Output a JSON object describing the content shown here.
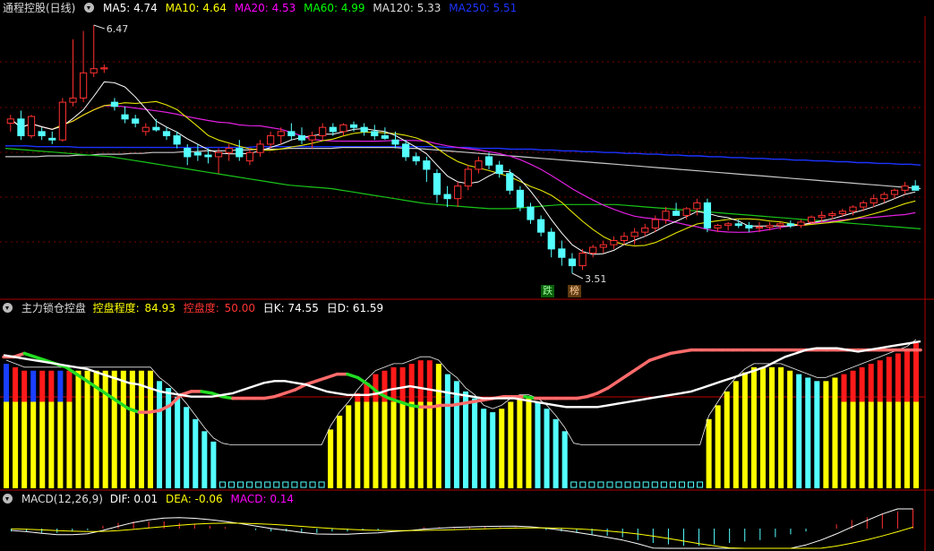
{
  "colors": {
    "ma5": "#ffffff",
    "ma10": "#ffff00",
    "ma20": "#ff00ff",
    "ma60": "#00ff00",
    "ma120": "#ffffff",
    "ma250": "#0000ff",
    "up": "#ff3030",
    "down": "#54ffff",
    "grid": "#7a0000"
  },
  "main": {
    "title": "通程控股(日线)",
    "indicators": [
      {
        "label": "MA5: 4.74",
        "color": "#ffffff"
      },
      {
        "label": "MA10: 4.64",
        "color": "#ffff00"
      },
      {
        "label": "MA20: 4.53",
        "color": "#ff00ff"
      },
      {
        "label": "MA60: 4.99",
        "color": "#00ff00"
      },
      {
        "label": "MA120: 5.33",
        "color": "#ffffff"
      },
      {
        "label": "MA250: 5.51",
        "color": "#0000ff"
      }
    ],
    "high_label": "6.47",
    "low_label": "3.51",
    "marker_fall": "跌",
    "marker_rank": "榜"
  },
  "panel2": {
    "title": "主力锁仓控盘",
    "items": [
      {
        "label": "控盘程度:",
        "color": "#ffff00"
      },
      {
        "label": "84.93",
        "color": "#ffff00"
      },
      {
        "label": "控盘度:",
        "color": "#ff3030"
      },
      {
        "label": "50.00",
        "color": "#ff3030"
      },
      {
        "label": "日K: 74.55",
        "color": "#ffffff"
      },
      {
        "label": "日D: 61.59",
        "color": "#ffffff"
      }
    ]
  },
  "macd": {
    "title": "MACD(12,26,9)",
    "items": [
      {
        "label": "DIF: 0.01",
        "color": "#ffffff"
      },
      {
        "label": "DEA: -0.06",
        "color": "#ffff00"
      },
      {
        "label": "MACD: 0.14",
        "color": "#ff00ff"
      }
    ]
  },
  "chart_data": {
    "type": "candlestick",
    "candles": [
      [
        5.3,
        5.4,
        5.2,
        5.35
      ],
      [
        5.35,
        5.45,
        5.1,
        5.15
      ],
      [
        5.15,
        5.4,
        5.12,
        5.38
      ],
      [
        5.2,
        5.25,
        5.1,
        5.15
      ],
      [
        5.12,
        5.2,
        5.05,
        5.1
      ],
      [
        5.1,
        5.6,
        5.08,
        5.55
      ],
      [
        5.55,
        6.3,
        5.5,
        5.6
      ],
      [
        5.6,
        6.4,
        5.55,
        5.9
      ],
      [
        5.9,
        6.47,
        5.85,
        5.95
      ],
      [
        5.95,
        6.0,
        5.9,
        5.96
      ],
      [
        5.55,
        5.6,
        5.45,
        5.5
      ],
      [
        5.4,
        5.5,
        5.3,
        5.35
      ],
      [
        5.35,
        5.4,
        5.25,
        5.3
      ],
      [
        5.2,
        5.3,
        5.15,
        5.25
      ],
      [
        5.25,
        5.35,
        5.2,
        5.22
      ],
      [
        5.2,
        5.25,
        5.1,
        5.15
      ],
      [
        5.15,
        5.2,
        5.0,
        5.05
      ],
      [
        5.0,
        5.05,
        4.8,
        4.9
      ],
      [
        4.95,
        5.05,
        4.85,
        4.92
      ],
      [
        4.92,
        5.0,
        4.82,
        4.9
      ],
      [
        4.9,
        5.0,
        4.7,
        4.95
      ],
      [
        4.95,
        5.05,
        4.85,
        5.0
      ],
      [
        5.0,
        5.1,
        4.85,
        4.9
      ],
      [
        4.85,
        5.0,
        4.8,
        4.95
      ],
      [
        4.95,
        5.1,
        4.9,
        5.05
      ],
      [
        5.05,
        5.2,
        5.0,
        5.15
      ],
      [
        5.15,
        5.25,
        5.05,
        5.2
      ],
      [
        5.2,
        5.3,
        5.1,
        5.15
      ],
      [
        5.15,
        5.25,
        5.05,
        5.1
      ],
      [
        5.1,
        5.2,
        5.0,
        5.15
      ],
      [
        5.15,
        5.3,
        5.1,
        5.25
      ],
      [
        5.25,
        5.3,
        5.15,
        5.2
      ],
      [
        5.2,
        5.3,
        5.15,
        5.28
      ],
      [
        5.28,
        5.32,
        5.2,
        5.25
      ],
      [
        5.25,
        5.3,
        5.15,
        5.2
      ],
      [
        5.2,
        5.28,
        5.1,
        5.15
      ],
      [
        5.15,
        5.25,
        5.1,
        5.12
      ],
      [
        5.1,
        5.2,
        5.0,
        5.05
      ],
      [
        5.05,
        5.1,
        4.85,
        4.9
      ],
      [
        4.9,
        4.95,
        4.8,
        4.85
      ],
      [
        4.85,
        4.9,
        4.6,
        4.75
      ],
      [
        4.7,
        4.75,
        4.35,
        4.45
      ],
      [
        4.45,
        4.55,
        4.3,
        4.4
      ],
      [
        4.4,
        4.6,
        4.3,
        4.55
      ],
      [
        4.55,
        4.8,
        4.5,
        4.75
      ],
      [
        4.75,
        4.9,
        4.7,
        4.85
      ],
      [
        4.9,
        4.95,
        4.75,
        4.8
      ],
      [
        4.8,
        4.85,
        4.65,
        4.7
      ],
      [
        4.7,
        4.75,
        4.45,
        4.5
      ],
      [
        4.5,
        4.55,
        4.25,
        4.3
      ],
      [
        4.3,
        4.35,
        4.1,
        4.15
      ],
      [
        4.15,
        4.2,
        3.95,
        4.0
      ],
      [
        4.0,
        4.05,
        3.7,
        3.8
      ],
      [
        3.8,
        3.9,
        3.6,
        3.7
      ],
      [
        3.68,
        3.75,
        3.51,
        3.6
      ],
      [
        3.6,
        3.8,
        3.55,
        3.75
      ],
      [
        3.75,
        3.85,
        3.7,
        3.82
      ],
      [
        3.82,
        3.9,
        3.75,
        3.85
      ],
      [
        3.85,
        3.95,
        3.8,
        3.9
      ],
      [
        3.9,
        4.0,
        3.85,
        3.95
      ],
      [
        3.95,
        4.05,
        3.85,
        4.0
      ],
      [
        4.0,
        4.1,
        3.95,
        4.05
      ],
      [
        4.05,
        4.2,
        4.0,
        4.15
      ],
      [
        4.15,
        4.3,
        4.1,
        4.25
      ],
      [
        4.25,
        4.35,
        4.2,
        4.2
      ],
      [
        4.2,
        4.3,
        4.15,
        4.28
      ],
      [
        4.28,
        4.4,
        4.2,
        4.35
      ],
      [
        4.35,
        4.4,
        4.0,
        4.05
      ],
      [
        4.05,
        4.1,
        4.0,
        4.08
      ],
      [
        4.08,
        4.12,
        4.02,
        4.1
      ],
      [
        4.1,
        4.15,
        4.05,
        4.08
      ],
      [
        4.08,
        4.12,
        4.0,
        4.05
      ],
      [
        4.05,
        4.12,
        4.0,
        4.06
      ],
      [
        4.06,
        4.12,
        4.02,
        4.08
      ],
      [
        4.08,
        4.12,
        4.03,
        4.1
      ],
      [
        4.1,
        4.14,
        4.05,
        4.08
      ],
      [
        4.08,
        4.15,
        4.05,
        4.12
      ],
      [
        4.12,
        4.2,
        4.1,
        4.18
      ],
      [
        4.18,
        4.25,
        4.12,
        4.2
      ],
      [
        4.2,
        4.25,
        4.15,
        4.22
      ],
      [
        4.22,
        4.28,
        4.18,
        4.25
      ],
      [
        4.25,
        4.32,
        4.2,
        4.3
      ],
      [
        4.3,
        4.38,
        4.25,
        4.35
      ],
      [
        4.35,
        4.45,
        4.3,
        4.4
      ],
      [
        4.4,
        4.48,
        4.35,
        4.45
      ],
      [
        4.45,
        4.52,
        4.4,
        4.5
      ],
      [
        4.5,
        4.6,
        4.45,
        4.55
      ],
      [
        4.55,
        4.62,
        4.5,
        4.5
      ]
    ],
    "ma_long": {
      "ma60": [
        5.0,
        4.99,
        4.98,
        4.97,
        4.96,
        4.95,
        4.94,
        4.93,
        4.92,
        4.91,
        4.9,
        4.88,
        4.86,
        4.84,
        4.82,
        4.8,
        4.78,
        4.76,
        4.74,
        4.72,
        4.7,
        4.68,
        4.66,
        4.64,
        4.62,
        4.6,
        4.58,
        4.56,
        4.55,
        4.54,
        4.53,
        4.52,
        4.5,
        4.48,
        4.46,
        4.44,
        4.42,
        4.4,
        4.38,
        4.36,
        4.34,
        4.33,
        4.32,
        4.31,
        4.3,
        4.29,
        4.28,
        4.28,
        4.28,
        4.29,
        4.3,
        4.31,
        4.32,
        4.33,
        4.33,
        4.33,
        4.33,
        4.33,
        4.33,
        4.32,
        4.31,
        4.3,
        4.29,
        4.28,
        4.27,
        4.26,
        4.25,
        4.24,
        4.23,
        4.22,
        4.21,
        4.2,
        4.19,
        4.18,
        4.17,
        4.16,
        4.15,
        4.14,
        4.13,
        4.12,
        4.11,
        4.1,
        4.09,
        4.08,
        4.07,
        4.06,
        4.05,
        4.04
      ],
      "ma250": [
        5.03,
        5.03,
        5.03,
        5.02,
        5.02,
        5.02,
        5.02,
        5.01,
        5.01,
        5.01,
        5.01,
        5.01,
        5.01,
        5.01,
        5.01,
        5.01,
        5.01,
        5.01,
        5.01,
        5.01,
        5.01,
        5.01,
        5.01,
        5.01,
        5.02,
        5.02,
        5.02,
        5.02,
        5.02,
        5.02,
        5.02,
        5.02,
        5.02,
        5.02,
        5.02,
        5.02,
        5.02,
        5.02,
        5.02,
        5.02,
        5.02,
        5.02,
        5.01,
        5.01,
        5.01,
        5.0,
        5.0,
        5.0,
        4.99,
        4.99,
        4.99,
        4.98,
        4.98,
        4.97,
        4.97,
        4.96,
        4.96,
        4.95,
        4.95,
        4.94,
        4.94,
        4.93,
        4.93,
        4.92,
        4.92,
        4.91,
        4.91,
        4.9,
        4.9,
        4.89,
        4.89,
        4.88,
        4.88,
        4.87,
        4.87,
        4.86,
        4.86,
        4.85,
        4.85,
        4.84,
        4.84,
        4.83,
        4.83,
        4.82,
        4.82,
        4.81,
        4.81,
        4.8
      ],
      "ma120": [
        4.9,
        4.9,
        4.9,
        4.9,
        4.91,
        4.91,
        4.91,
        4.92,
        4.92,
        4.93,
        4.93,
        4.93,
        4.94,
        4.94,
        4.95,
        4.95,
        4.95,
        4.96,
        4.96,
        4.97,
        4.97,
        4.97,
        4.98,
        4.98,
        4.99,
        4.99,
        4.99,
        5.0,
        5.0,
        5.0,
        5.0,
        5.0,
        5.01,
        5.01,
        5.01,
        5.01,
        5.01,
        5.01,
        5.0,
        5.0,
        4.99,
        4.98,
        4.97,
        4.96,
        4.95,
        4.94,
        4.93,
        4.92,
        4.91,
        4.9,
        4.89,
        4.88,
        4.87,
        4.86,
        4.85,
        4.84,
        4.83,
        4.82,
        4.81,
        4.8,
        4.79,
        4.78,
        4.77,
        4.76,
        4.75,
        4.74,
        4.73,
        4.72,
        4.71,
        4.7,
        4.69,
        4.68,
        4.67,
        4.66,
        4.65,
        4.64,
        4.63,
        4.62,
        4.61,
        4.6,
        4.59,
        4.58,
        4.57,
        4.56,
        4.55,
        4.54,
        4.53,
        4.52
      ]
    },
    "ctrl": {
      "bars": [
        72,
        70,
        68,
        68,
        68,
        68,
        68,
        68,
        68,
        68,
        68,
        68,
        68,
        68,
        68,
        68,
        68,
        62,
        58,
        53,
        47,
        40,
        33,
        27,
        24,
        23,
        23,
        23,
        23,
        23,
        23,
        23,
        23,
        23,
        23,
        23,
        34,
        42,
        48,
        55,
        61,
        66,
        68,
        70,
        70,
        72,
        74,
        74,
        72,
        66,
        62,
        56,
        52,
        46,
        44,
        46,
        50,
        52,
        52,
        50,
        46,
        40,
        33,
        24,
        23,
        23,
        23,
        23,
        23,
        23,
        23,
        23,
        23,
        23,
        23,
        23,
        23,
        23,
        40,
        48,
        56,
        62,
        67,
        70,
        70,
        70,
        70,
        68,
        66,
        64,
        62,
        62,
        64,
        66,
        68,
        70,
        72,
        74,
        76,
        78,
        80,
        84
      ],
      "white": [
        77,
        76,
        75,
        74,
        73,
        72,
        71,
        70,
        69,
        67,
        65,
        63,
        61,
        60,
        58,
        56,
        55,
        54,
        53,
        53,
        53,
        54,
        55,
        57,
        59,
        61,
        62,
        62,
        61,
        60,
        58,
        56,
        55,
        54,
        54,
        54,
        55,
        57,
        58,
        59,
        58,
        57,
        56,
        55,
        54,
        53,
        52,
        52,
        52,
        52,
        51,
        50,
        49,
        48,
        47,
        47,
        47,
        47,
        48,
        49,
        50,
        51,
        52,
        53,
        54,
        55,
        56,
        58,
        60,
        62,
        64,
        66,
        68,
        70,
        73,
        76,
        78,
        80,
        81,
        81,
        81,
        80,
        79,
        80,
        81,
        82,
        83,
        84,
        85
      ],
      "green": [
        76,
        76,
        78,
        76,
        74,
        72,
        70,
        66,
        62,
        58,
        54,
        50,
        46,
        44,
        44,
        45,
        48,
        54,
        56,
        56,
        55,
        53,
        52,
        52,
        52,
        52,
        53,
        55,
        57,
        60,
        62,
        64,
        66,
        66,
        64,
        60,
        55,
        52,
        50,
        48,
        47,
        47,
        48,
        48,
        49,
        50,
        51,
        52,
        53,
        53,
        53,
        52,
        52,
        52,
        52,
        52,
        53,
        55,
        58,
        62,
        66,
        70,
        74,
        76,
        78,
        79,
        80,
        80,
        80,
        80,
        80,
        80,
        80,
        80,
        80,
        80,
        80,
        80,
        80,
        80,
        80,
        80,
        80,
        80,
        80,
        80,
        80,
        80,
        80
      ]
    },
    "macd_hist": [
      -0.02,
      -0.02,
      -0.03,
      -0.03,
      -0.02,
      -0.01,
      0.02,
      0.04,
      0.05,
      0.05,
      0.05,
      0.04,
      0.03,
      0.02,
      0.01,
      0.0,
      -0.01,
      -0.02,
      -0.02,
      -0.03,
      -0.03,
      -0.02,
      -0.02,
      -0.01,
      -0.01,
      0.0,
      0.0,
      0.01,
      0.01,
      0.01,
      0.01,
      0.01,
      0.01,
      0.01,
      0.0,
      -0.01,
      -0.02,
      -0.03,
      -0.04,
      -0.05,
      -0.06,
      -0.08,
      -0.1,
      -0.11,
      -0.12,
      -0.12,
      -0.11,
      -0.1,
      -0.09,
      -0.08,
      -0.06,
      -0.04,
      -0.02,
      0.0,
      0.03,
      0.06,
      0.08,
      0.1,
      0.12,
      0.14
    ]
  }
}
